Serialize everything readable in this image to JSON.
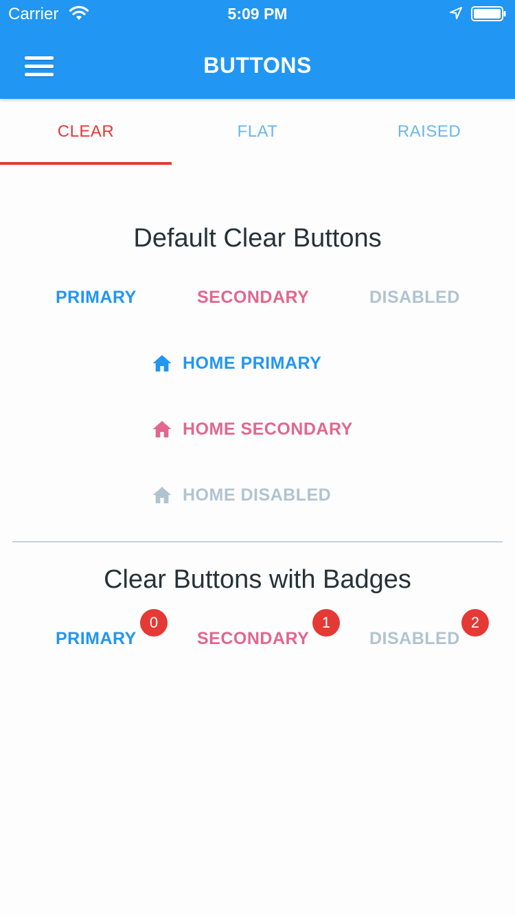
{
  "status_bar": {
    "carrier": "Carrier",
    "time": "5:09 PM"
  },
  "app_bar": {
    "title": "BUTTONS",
    "menu_icon": "hamburger-menu-icon"
  },
  "tabs": [
    {
      "label": "CLEAR",
      "active": true
    },
    {
      "label": "FLAT",
      "active": false
    },
    {
      "label": "RAISED",
      "active": false
    }
  ],
  "section_default": {
    "heading": "Default Clear Buttons",
    "buttons": [
      "PRIMARY",
      "SECONDARY",
      "DISABLED"
    ],
    "icon_buttons": [
      {
        "icon": "home-icon",
        "label": "HOME PRIMARY"
      },
      {
        "icon": "home-icon",
        "label": "HOME SECONDARY"
      },
      {
        "icon": "home-icon",
        "label": "HOME DISABLED"
      }
    ]
  },
  "section_badges": {
    "heading": "Clear Buttons with Badges",
    "buttons": [
      {
        "label": "PRIMARY",
        "badge": "0"
      },
      {
        "label": "SECONDARY",
        "badge": "1"
      },
      {
        "label": "DISABLED",
        "badge": "2"
      }
    ]
  },
  "colors": {
    "app_bar": "#2196f3",
    "primary": "#2196f3",
    "secondary": "#e2668d",
    "disabled": "#b0c4d0",
    "active_tab": "#e53935",
    "inactive_tab": "#6ab6f0",
    "badge": "#e53935"
  }
}
